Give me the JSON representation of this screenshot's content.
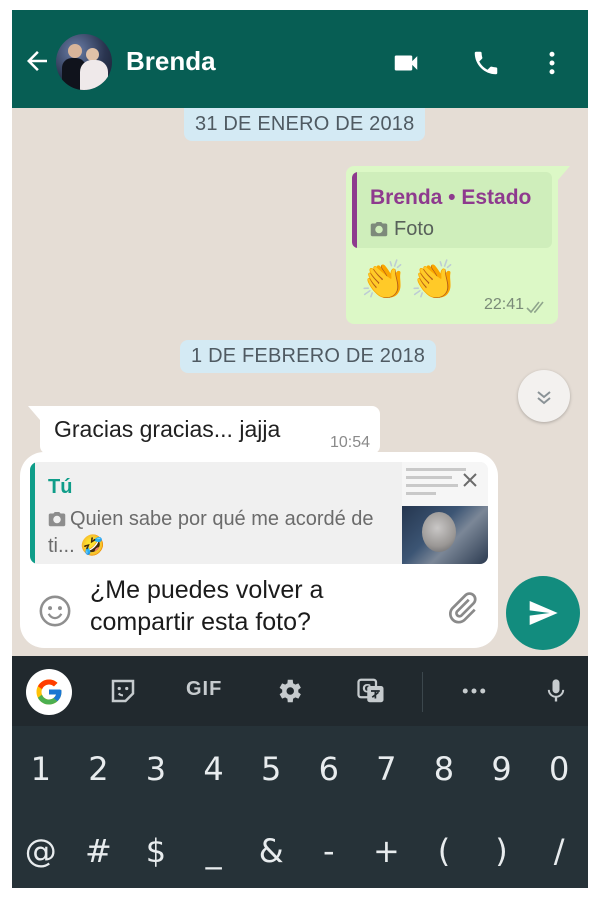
{
  "header": {
    "contact_name": "Brenda",
    "back_icon": "arrow-left-icon",
    "video_icon": "video-camera-icon",
    "call_icon": "phone-icon",
    "menu_icon": "more-vertical-icon",
    "bar_color": "#075e54"
  },
  "chat": {
    "date_1": "31 DE ENERO DE 2018",
    "date_2": "1 DE FEBRERO DE 2018",
    "outgoing": {
      "quoted_name": "Brenda • Estado",
      "quoted_type": "Foto",
      "emojis": [
        "👏",
        "👏"
      ],
      "time": "22:41",
      "status": "read"
    },
    "incoming": {
      "text": "Gracias gracias... jajja",
      "time": "10:54"
    }
  },
  "compose": {
    "reply_author": "Tú",
    "reply_text": "Quien sabe por qué me acordé de ti... 🤣",
    "message": "¿Me puedes volver a compartir esta foto?",
    "send_icon": "send-icon",
    "accent_color": "#0f9d89"
  },
  "keyboard": {
    "toolbar": {
      "gif_label": "GIF"
    },
    "number_row": [
      "1",
      "2",
      "3",
      "4",
      "5",
      "6",
      "7",
      "8",
      "9",
      "0"
    ],
    "symbol_row": [
      "@",
      "#",
      "$",
      "_",
      "&",
      "-",
      "+",
      "(",
      ")",
      "/"
    ]
  }
}
